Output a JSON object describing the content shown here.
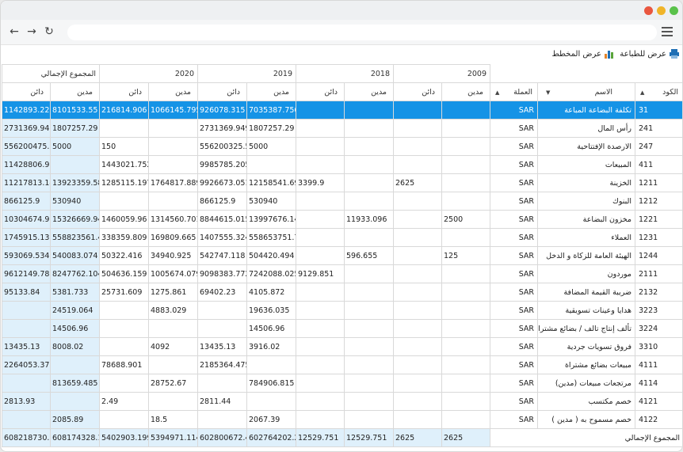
{
  "browser": {
    "traffic_lights": [
      "#e9563f",
      "#f0b429",
      "#58c14a"
    ]
  },
  "toolbar": {
    "print_label": "عرض للطباعة",
    "chart_label": "عرض المخطط"
  },
  "headers": {
    "years": [
      "المجموع الإجمالي",
      "2020",
      "2019",
      "2018",
      "2009"
    ],
    "credit": "دائن",
    "debit": "مدين",
    "currency": "العملة",
    "name": "الاسم",
    "code": "الكود"
  },
  "rows": [
    {
      "code": "31",
      "name": "تكلفة البضاعة المباعة",
      "cur": "SAR",
      "v": [
        "1142893.22",
        "8101533.55",
        "216814.906",
        "1066145.795",
        "926078.315",
        "7035387.756",
        "",
        "",
        "",
        ""
      ]
    },
    {
      "code": "241",
      "name": "رأس المال",
      "cur": "SAR",
      "v": [
        "2731369.949",
        "1807257.29",
        "",
        "",
        "2731369.949",
        "1807257.29",
        "",
        "",
        "",
        ""
      ]
    },
    {
      "code": "247",
      "name": "الارصدة الإفتتاحية",
      "cur": "SAR",
      "v": [
        "556200475.5!",
        "5000",
        "150",
        "",
        "556200325.5",
        "5000",
        "",
        "",
        "",
        ""
      ]
    },
    {
      "code": "411",
      "name": "المبيعات",
      "cur": "SAR",
      "v": [
        "11428806.957",
        "",
        "1443021.752",
        "",
        "9985785.205",
        "",
        "",
        "",
        "",
        ""
      ]
    },
    {
      "code": "1211",
      "name": "الخزينة",
      "cur": "SAR",
      "v": [
        "11217813.147",
        "13923359.58!",
        "1285115.197",
        "1764817.889",
        "9926673.051",
        "12158541.693",
        "3399.9",
        "",
        "2625",
        ""
      ]
    },
    {
      "code": "1212",
      "name": "البنوك",
      "cur": "SAR",
      "v": [
        "866125.9",
        "530940",
        "",
        "",
        "866125.9",
        "530940",
        "",
        "",
        "",
        ""
      ]
    },
    {
      "code": "1221",
      "name": "مخزون البضاعة",
      "cur": "SAR",
      "v": [
        "10304674.975",
        "15326669.94!",
        "1460059.96",
        "1314560.701",
        "8844615.015",
        "13997676.148",
        "",
        "11933.096",
        "",
        "2500"
      ]
    },
    {
      "code": "1231",
      "name": "العملاء",
      "cur": "SAR",
      "v": [
        "1745915.133",
        "558823561.4!",
        "338359.809",
        "169809.665",
        "1407555.324",
        "558653751.78",
        "",
        "",
        "",
        ""
      ]
    },
    {
      "code": "1244",
      "name": "الهيئة العامة للزكاة و الدخل",
      "cur": "SAR",
      "v": [
        "593069.534",
        "540083.074",
        "50322.416",
        "34940.925",
        "542747.118",
        "504420.494",
        "",
        "596.655",
        "",
        "125"
      ]
    },
    {
      "code": "2111",
      "name": "موردون",
      "cur": "SAR",
      "v": [
        "9612149.782",
        "8247762.104",
        "504636.159",
        "1005674.079",
        "9098383.772",
        "7242088.025",
        "9129.851",
        "",
        "",
        ""
      ]
    },
    {
      "code": "2132",
      "name": "ضريبة القيمة المضافة",
      "cur": "SAR",
      "v": [
        "95133.84",
        "5381.733",
        "25731.609",
        "1275.861",
        "69402.23",
        "4105.872",
        "",
        "",
        "",
        ""
      ]
    },
    {
      "code": "3223",
      "name": "هدايا وعينات تسويقية",
      "cur": "SAR",
      "v": [
        "",
        "24519.064",
        "",
        "4883.029",
        "",
        "19636.035",
        "",
        "",
        "",
        ""
      ]
    },
    {
      "code": "3224",
      "name": "تألف إنتاج تالف / بضائع مشتراة (...",
      "cur": "SAR",
      "v": [
        "",
        "14506.96",
        "",
        "",
        "",
        "14506.96",
        "",
        "",
        "",
        ""
      ]
    },
    {
      "code": "3310",
      "name": "فروق تسويات جردية",
      "cur": "SAR",
      "v": [
        "13435.13",
        "8008.02",
        "",
        "4092",
        "13435.13",
        "3916.02",
        "",
        "",
        "",
        ""
      ]
    },
    {
      "code": "4111",
      "name": "مبيعات بضائع مشتراة",
      "cur": "SAR",
      "v": [
        "2264053.376",
        "",
        "78688.901",
        "",
        "2185364.475",
        "",
        "",
        "",
        "",
        ""
      ]
    },
    {
      "code": "4114",
      "name": "مرتجعات مبيعات (مدين)",
      "cur": "SAR",
      "v": [
        "",
        "813659.485",
        "",
        "28752.67",
        "",
        "784906.815",
        "",
        "",
        "",
        ""
      ]
    },
    {
      "code": "4121",
      "name": "خصم مكتسب",
      "cur": "SAR",
      "v": [
        "2813.93",
        "",
        "2.49",
        "",
        "2811.44",
        "",
        "",
        "",
        "",
        ""
      ]
    },
    {
      "code": "4122",
      "name": "خصم مسموح به ( مدين )",
      "cur": "SAR",
      "v": [
        "",
        "2085.89",
        "",
        "18.5",
        "",
        "2067.39",
        "",
        "",
        "",
        ""
      ]
    }
  ],
  "totals": {
    "label": "المجموع الإجمالي",
    "v": [
      "608218730.39",
      "608174328.15",
      "5402903.199",
      "5394971.114",
      "602800672.4!",
      "602764202.21",
      "12529.751",
      "12529.751",
      "2625",
      "2625"
    ]
  }
}
